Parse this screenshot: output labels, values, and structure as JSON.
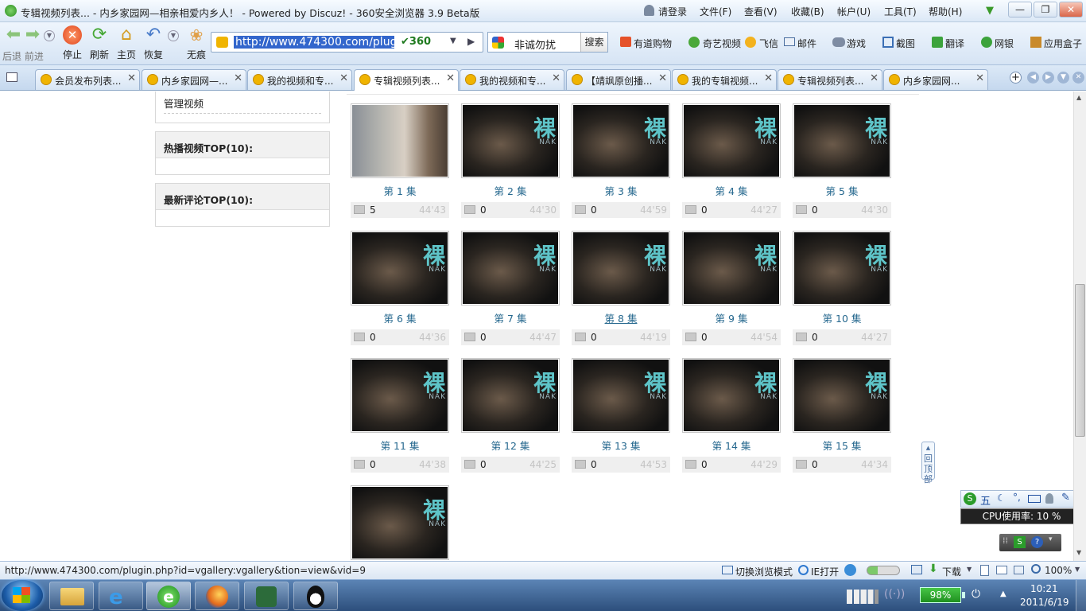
{
  "window": {
    "title": "专辑视频列表... - 内乡家园网—相亲相爱内乡人！ - Powered by Discuz! - 360安全浏览器 3.9 Beta版",
    "menu": [
      "请登录",
      "文件(F)",
      "查看(V)",
      "收藏(B)",
      "帐户(U)",
      "工具(T)",
      "帮助(H)"
    ]
  },
  "toolbar": {
    "back_forward": "后退 前进",
    "stop": "停止",
    "refresh": "刷新",
    "home": "主页",
    "restore": "恢复",
    "incognito": "无痕",
    "url": "http://www.474300.com/plugi",
    "search_value": "非诚勿扰",
    "search_button": "搜索",
    "links": [
      "有道购物",
      "奇艺视频",
      "飞信",
      "邮件",
      "游戏",
      "截图",
      "翻译",
      "网银",
      "应用盒子"
    ]
  },
  "tabs": [
    {
      "label": "会员发布列表..."
    },
    {
      "label": "内乡家园网—..."
    },
    {
      "label": "我的视频和专..."
    },
    {
      "label": "专辑视频列表..."
    },
    {
      "label": "我的视频和专..."
    },
    {
      "label": "【靖飒原创播..."
    },
    {
      "label": "我的专辑视频..."
    },
    {
      "label": "专辑视频列表..."
    },
    {
      "label": "内乡家园网..."
    }
  ],
  "sidebar": {
    "manage_video": "管理视频",
    "hot_top": "热播视频TOP(10):",
    "latest_comments": "最新评论TOP(10):"
  },
  "thumb_text": {
    "glyph": "裸",
    "nak": "NAK"
  },
  "episodes": [
    {
      "label": "第 1 集",
      "views": "5",
      "duration": "44'43"
    },
    {
      "label": "第 2 集",
      "views": "0",
      "duration": "44'30"
    },
    {
      "label": "第 3 集",
      "views": "0",
      "duration": "44'59"
    },
    {
      "label": "第 4 集",
      "views": "0",
      "duration": "44'27"
    },
    {
      "label": "第 5 集",
      "views": "0",
      "duration": "44'30"
    },
    {
      "label": "第 6 集",
      "views": "0",
      "duration": "44'36"
    },
    {
      "label": "第 7 集",
      "views": "0",
      "duration": "44'47"
    },
    {
      "label": "第 8 集",
      "views": "0",
      "duration": "44'19"
    },
    {
      "label": "第 9 集",
      "views": "0",
      "duration": "44'54"
    },
    {
      "label": "第 10 集",
      "views": "0",
      "duration": "44'27"
    },
    {
      "label": "第 11 集",
      "views": "0",
      "duration": "44'38"
    },
    {
      "label": "第 12 集",
      "views": "0",
      "duration": "44'25"
    },
    {
      "label": "第 13 集",
      "views": "0",
      "duration": "44'53"
    },
    {
      "label": "第 14 集",
      "views": "0",
      "duration": "44'29"
    },
    {
      "label": "第 15 集",
      "views": "0",
      "duration": "44'34"
    }
  ],
  "back_to_top": "回顶部",
  "ime": {
    "cpu_label": "CPU使用率: 10 %",
    "mode": "五"
  },
  "statusbar": {
    "link": "http://www.474300.com/plugin.php?id=vgallery:vgallery&tion=view&vid=9",
    "switch_mode": "切换浏览模式",
    "ie_open": "IE打开",
    "download": "下载",
    "zoom": "100%"
  },
  "tray": {
    "battery": "98%",
    "time": "10:21",
    "date": "2011/6/19"
  },
  "colors": {
    "link": "#27698f",
    "accent": "#3366cc"
  }
}
